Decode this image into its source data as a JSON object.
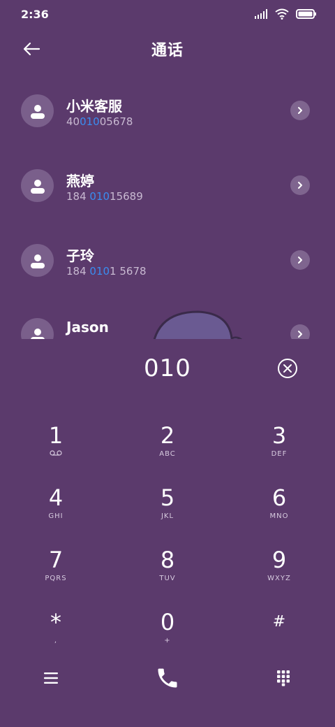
{
  "status_bar": {
    "time": "2:36",
    "icons": [
      "signal-icon",
      "wifi-icon",
      "battery-icon"
    ]
  },
  "header": {
    "title": "通话",
    "back_icon": "arrow-left-icon"
  },
  "colors": {
    "background": "#5b3a6c",
    "highlight": "#3a8df0",
    "secondary_text": "#c8b9d1"
  },
  "contacts": [
    {
      "name": "小米客服",
      "number_parts": [
        "40",
        "010",
        "05678"
      ]
    },
    {
      "name": "燕婷",
      "number_parts": [
        "184 ",
        "010",
        "15689"
      ]
    },
    {
      "name": "子玲",
      "number_parts": [
        "184 ",
        "010",
        "1 5678"
      ]
    },
    {
      "name": "Jason",
      "number_parts": [
        "",
        "",
        ""
      ]
    }
  ],
  "dialer": {
    "input_value": "010",
    "clear_icon": "clear-circle-x-icon",
    "keys": [
      {
        "digit": "1",
        "letters": ""
      },
      {
        "digit": "2",
        "letters": "ABC"
      },
      {
        "digit": "3",
        "letters": "DEF"
      },
      {
        "digit": "4",
        "letters": "GHI"
      },
      {
        "digit": "5",
        "letters": "JKL"
      },
      {
        "digit": "6",
        "letters": "MNO"
      },
      {
        "digit": "7",
        "letters": "PQRS"
      },
      {
        "digit": "8",
        "letters": "TUV"
      },
      {
        "digit": "9",
        "letters": "WXYZ"
      },
      {
        "digit": "*",
        "letters": ","
      },
      {
        "digit": "0",
        "letters": "+"
      },
      {
        "digit": "#",
        "letters": ""
      }
    ]
  },
  "bottom_bar": {
    "menu_icon": "menu-icon",
    "call_icon": "phone-icon",
    "keypad_icon": "keypad-icon"
  }
}
